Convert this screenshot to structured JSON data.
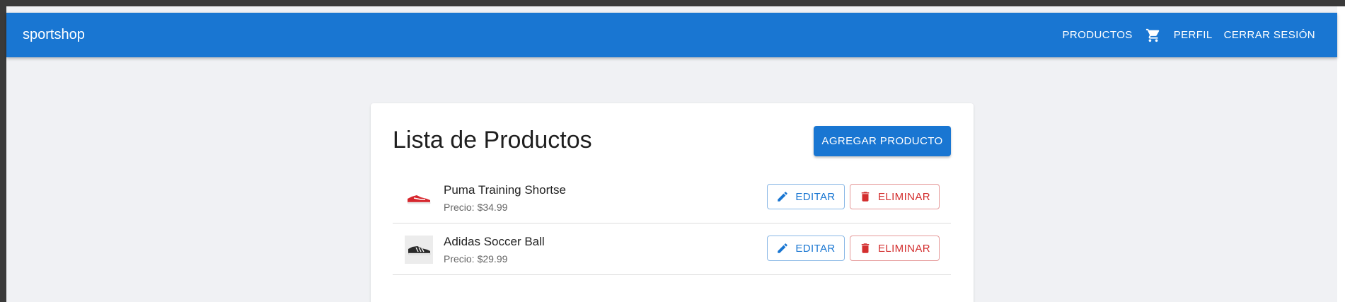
{
  "appbar": {
    "brand": "sportshop",
    "nav_productos": "PRODUCTOS",
    "cart_icon": "shopping-cart-icon",
    "nav_perfil": "PERFIL",
    "nav_cerrar_sesion": "CERRAR SESIÓN",
    "color": "#1976d2"
  },
  "main": {
    "title": "Lista de Productos",
    "add_button_label": "AGREGAR PRODUCTO",
    "products": [
      {
        "name": "Puma Training Shortse",
        "price_label": "Precio:",
        "price": "$34.99",
        "thumbnail_icon": "red-sneaker-image",
        "edit_label": "EDITAR",
        "delete_label": "ELIMINAR"
      },
      {
        "name": "Adidas Soccer Ball",
        "price_label": "Precio:",
        "price": "$29.99",
        "thumbnail_icon": "black-sneaker-image",
        "edit_label": "EDITAR",
        "delete_label": "ELIMINAR"
      }
    ],
    "colors": {
      "primary": "#1976d2",
      "danger": "#d32f2f"
    }
  }
}
